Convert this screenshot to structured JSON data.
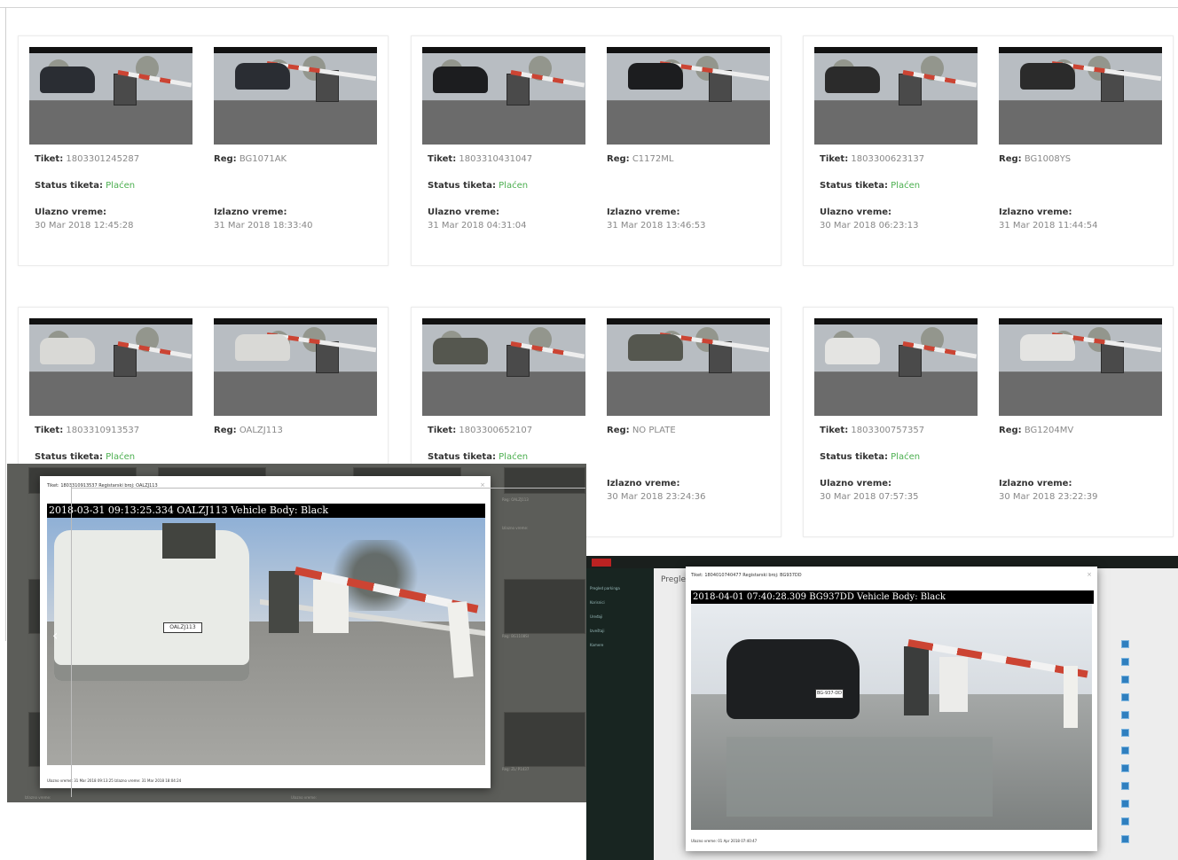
{
  "cards": [
    {
      "ticket": "1803301245287",
      "reg": "BG1071AK",
      "status": "Plaćen",
      "entry": "30 Mar 2018 12:45:28",
      "exit": "31 Mar 2018 18:33:40",
      "show_status": true,
      "show_times": true,
      "thumbs": [
        "Ulaz",
        "Izlaz"
      ]
    },
    {
      "ticket": "1803310431047",
      "reg": "C1172ML",
      "status": "Plaćen",
      "entry": "31 Mar 2018 04:31:04",
      "exit": "31 Mar 2018 13:46:53",
      "show_status": true,
      "show_times": true,
      "thumbs": [
        "Ulaz",
        "Izlaz"
      ]
    },
    {
      "ticket": "1803300623137",
      "reg": "BG1008YS",
      "status": "Plaćen",
      "entry": "30 Mar 2018 06:23:13",
      "exit": "31 Mar 2018 11:44:54",
      "show_status": true,
      "show_times": true,
      "thumbs": [
        "Ulaz",
        "Izlaz"
      ]
    },
    {
      "ticket": "1803310913537",
      "reg": "OALZJ113",
      "status": "Plaćen",
      "entry": "",
      "exit": "",
      "show_status": true,
      "show_times": false,
      "thumbs": [
        "Ulaz",
        "Izlaz"
      ]
    },
    {
      "ticket": "1803300652107",
      "reg": "NO PLATE",
      "status": "Plaćen",
      "entry": "",
      "exit": "30 Mar 2018 23:24:36",
      "show_status": true,
      "show_times": true,
      "thumbs": [
        "Ulaz",
        "Izlaz"
      ]
    },
    {
      "ticket": "1803300757357",
      "reg": "BG1204MV",
      "status": "Plaćen",
      "entry": "30 Mar 2018 07:57:35",
      "exit": "30 Mar 2018 23:22:39",
      "show_status": true,
      "show_times": true,
      "thumbs": [
        "Ulaz",
        "Izlaz"
      ]
    }
  ],
  "labels": {
    "ticket": "Tiket:",
    "reg": "Reg:",
    "status": "Status tiketa:",
    "entry": "Ulazno vreme:",
    "exit": "Izlazno vreme:"
  },
  "modal_left": {
    "header": "Tiket: 1803310913537 Registarski broj: OALZJ113",
    "photo_caption": "2018-03-31 09:13:25.334 OALZJ113 Vehicle Body: Black",
    "plate": "OALZJ113",
    "footer": "Ulazno vreme: 31 Mar 2018 09:13:25    Izlazno vreme: 31 Mar 2018 18:04:24",
    "nav_prev": "‹"
  },
  "modal_right": {
    "header": "Tiket: 1804010740477 Registarski broj: BG937DD",
    "photo_caption": "2018-04-01 07:40:28.309 BG937DD Vehicle Body: Black",
    "plate": "BG-937-DD",
    "footer": "Ulazno vreme: 01 Apr 2018 07:40:47",
    "bg_title": "Pregled"
  },
  "colors": {
    "status_green": "#4caf50",
    "barrier_red": "#c43",
    "dark_app": "#21302b",
    "overlay_gray": "#5c5d59"
  }
}
